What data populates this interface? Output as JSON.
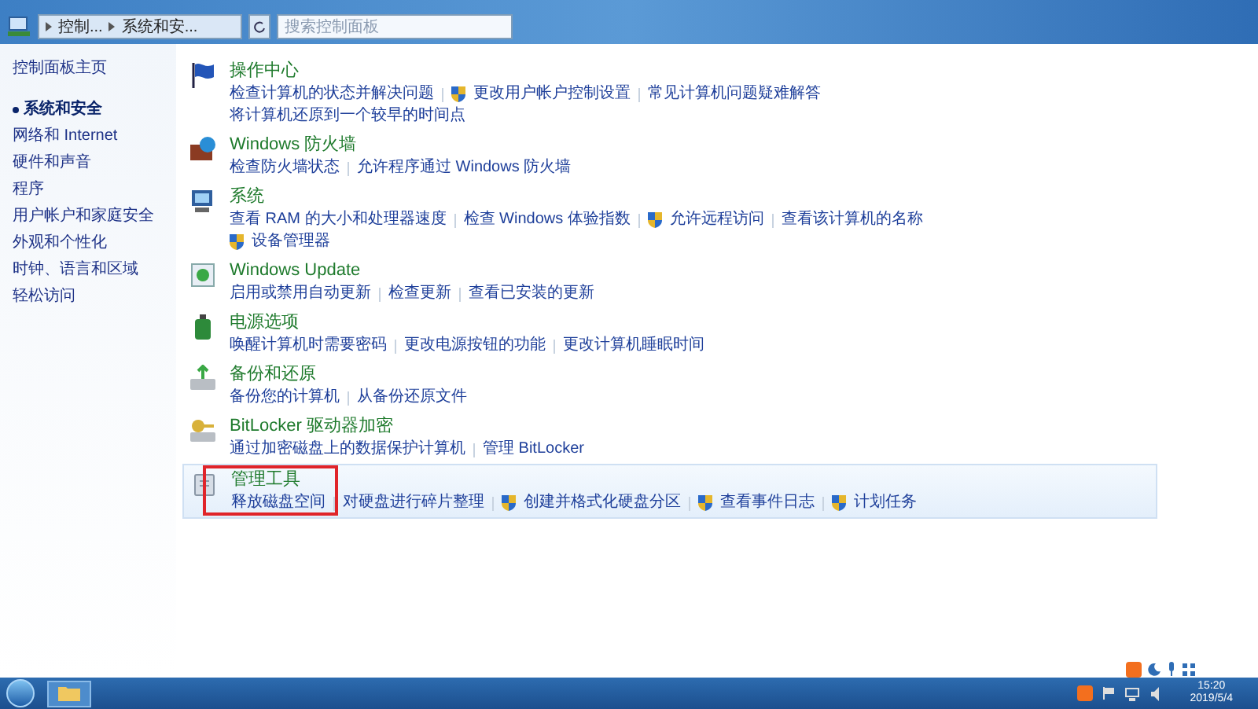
{
  "address_bar": {
    "breadcrumbs": [
      "控制...",
      "系统和安..."
    ]
  },
  "search": {
    "placeholder": "搜索控制面板"
  },
  "sidebar": {
    "home": "控制面板主页",
    "items": [
      {
        "label": "系统和安全",
        "selected": true
      },
      {
        "label": "网络和 Internet",
        "selected": false
      },
      {
        "label": "硬件和声音",
        "selected": false
      },
      {
        "label": "程序",
        "selected": false
      },
      {
        "label": "用户帐户和家庭安全",
        "selected": false
      },
      {
        "label": "外观和个性化",
        "selected": false
      },
      {
        "label": "时钟、语言和区域",
        "selected": false
      },
      {
        "label": "轻松访问",
        "selected": false
      }
    ]
  },
  "sections": [
    {
      "title": "操作中心",
      "highlighted": false,
      "lines": [
        [
          {
            "text": "检查计算机的状态并解决问题",
            "shield": false
          },
          {
            "text": "更改用户帐户控制设置",
            "shield": true
          },
          {
            "text": "常见计算机问题疑难解答",
            "shield": false
          }
        ],
        [
          {
            "text": "将计算机还原到一个较早的时间点",
            "shield": false
          }
        ]
      ]
    },
    {
      "title": "Windows 防火墙",
      "highlighted": false,
      "lines": [
        [
          {
            "text": "检查防火墙状态",
            "shield": false
          },
          {
            "text": "允许程序通过 Windows 防火墙",
            "shield": false
          }
        ]
      ]
    },
    {
      "title": "系统",
      "highlighted": false,
      "lines": [
        [
          {
            "text": "查看 RAM 的大小和处理器速度",
            "shield": false
          },
          {
            "text": "检查 Windows 体验指数",
            "shield": false
          },
          {
            "text": "允许远程访问",
            "shield": true
          },
          {
            "text": "查看该计算机的名称",
            "shield": false
          }
        ],
        [
          {
            "text": "设备管理器",
            "shield": true
          }
        ]
      ]
    },
    {
      "title": "Windows Update",
      "highlighted": false,
      "lines": [
        [
          {
            "text": "启用或禁用自动更新",
            "shield": false
          },
          {
            "text": "检查更新",
            "shield": false
          },
          {
            "text": "查看已安装的更新",
            "shield": false
          }
        ]
      ]
    },
    {
      "title": "电源选项",
      "highlighted": false,
      "lines": [
        [
          {
            "text": "唤醒计算机时需要密码",
            "shield": false
          },
          {
            "text": "更改电源按钮的功能",
            "shield": false
          },
          {
            "text": "更改计算机睡眠时间",
            "shield": false
          }
        ]
      ]
    },
    {
      "title": "备份和还原",
      "highlighted": false,
      "lines": [
        [
          {
            "text": "备份您的计算机",
            "shield": false
          },
          {
            "text": "从备份还原文件",
            "shield": false
          }
        ]
      ]
    },
    {
      "title": "BitLocker 驱动器加密",
      "highlighted": false,
      "lines": [
        [
          {
            "text": "通过加密磁盘上的数据保护计算机",
            "shield": false
          },
          {
            "text": "管理 BitLocker",
            "shield": false
          }
        ]
      ]
    },
    {
      "title": "管理工具",
      "highlighted": true,
      "lines": [
        [
          {
            "text": "释放磁盘空间",
            "shield": false
          },
          {
            "text": "对硬盘进行碎片整理",
            "shield": false
          },
          {
            "text": "创建并格式化硬盘分区",
            "shield": true
          },
          {
            "text": "查看事件日志",
            "shield": true
          },
          {
            "text": "计划任务",
            "shield": true
          }
        ]
      ]
    }
  ],
  "taskbar": {
    "time": "15:20",
    "date": "2019/5/4"
  }
}
